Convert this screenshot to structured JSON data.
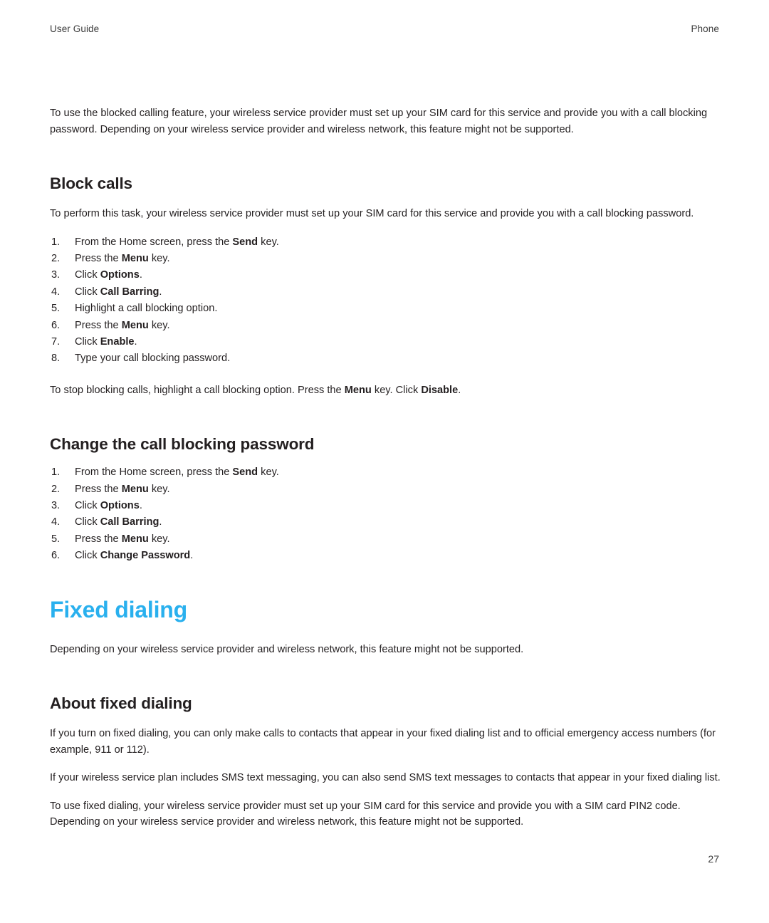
{
  "running_head": {
    "left": "User Guide",
    "right": "Phone"
  },
  "intro_paragraph": "To use the blocked calling feature, your wireless service provider must set up your SIM card for this service and provide you with a call blocking password. Depending on your wireless service provider and wireless network, this feature might not be supported.",
  "block_calls": {
    "heading": "Block calls",
    "intro": "To perform this task, your wireless service provider must set up your SIM card for this service and provide you with a call blocking password.",
    "steps": [
      {
        "pre": "From the Home screen, press the ",
        "bold": "Send",
        "post": " key."
      },
      {
        "pre": "Press the ",
        "bold": "Menu",
        "post": " key."
      },
      {
        "pre": "Click ",
        "bold": "Options",
        "post": "."
      },
      {
        "pre": "Click ",
        "bold": "Call Barring",
        "post": "."
      },
      {
        "pre": "Highlight a call blocking option.",
        "bold": "",
        "post": ""
      },
      {
        "pre": "Press the ",
        "bold": "Menu",
        "post": " key."
      },
      {
        "pre": "Click ",
        "bold": "Enable",
        "post": "."
      },
      {
        "pre": "Type your call blocking password.",
        "bold": "",
        "post": ""
      }
    ],
    "outro": {
      "pre": "To stop blocking calls, highlight a call blocking option. Press the ",
      "bold1": "Menu",
      "mid": " key. Click ",
      "bold2": "Disable",
      "post": "."
    }
  },
  "change_password": {
    "heading": "Change the call blocking password",
    "steps": [
      {
        "pre": "From the Home screen, press the ",
        "bold": "Send",
        "post": " key."
      },
      {
        "pre": "Press the ",
        "bold": "Menu",
        "post": " key."
      },
      {
        "pre": "Click ",
        "bold": "Options",
        "post": "."
      },
      {
        "pre": "Click ",
        "bold": "Call Barring",
        "post": "."
      },
      {
        "pre": "Press the ",
        "bold": "Menu",
        "post": " key."
      },
      {
        "pre": "Click ",
        "bold": "Change Password",
        "post": "."
      }
    ]
  },
  "fixed_dialing": {
    "heading": "Fixed dialing",
    "heading_color": "#29b0ee",
    "intro": "Depending on your wireless service provider and wireless network, this feature might not be supported.",
    "about": {
      "heading": "About fixed dialing",
      "paragraphs": [
        "If you turn on fixed dialing, you can only make calls to contacts that appear in your fixed dialing list and to official emergency access numbers (for example, 911 or 112).",
        "If your wireless service plan includes SMS text messaging, you can also send SMS text messages to contacts that appear in your fixed dialing list.",
        "To use fixed dialing, your wireless service provider must set up your SIM card for this service and provide you with a SIM card PIN2 code. Depending on your wireless service provider and wireless network, this feature might not be supported."
      ]
    }
  },
  "page_number": "27"
}
